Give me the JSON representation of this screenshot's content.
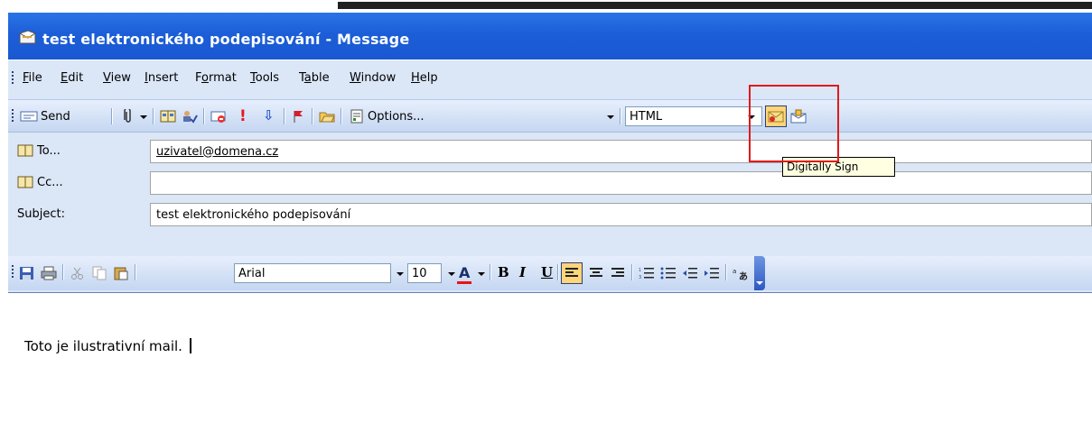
{
  "window": {
    "title": "test elektronického podepisování - Message"
  },
  "menu": [
    "File",
    "Edit",
    "View",
    "Insert",
    "Format",
    "Tools",
    "Table",
    "Window",
    "Help"
  ],
  "toolbar": {
    "send_label": "Send",
    "options_label": "Options...",
    "format_value": "HTML",
    "tooltip": "Digitally Sign"
  },
  "fields": {
    "to_label": "To...",
    "to_value": "uzivatel@domena.cz",
    "cc_label": "Cc...",
    "cc_value": "",
    "subject_label": "Subject:",
    "subject_value": "test elektronického podepisování"
  },
  "format_toolbar": {
    "font": "Arial",
    "size": "10"
  },
  "message": {
    "body": "Toto je ilustrativní mail."
  },
  "colors": {
    "title_bar": "#1c5ed8",
    "chrome": "#dbe6f7",
    "highlight": "#ffd47a",
    "annotation": "#e01a1a"
  }
}
